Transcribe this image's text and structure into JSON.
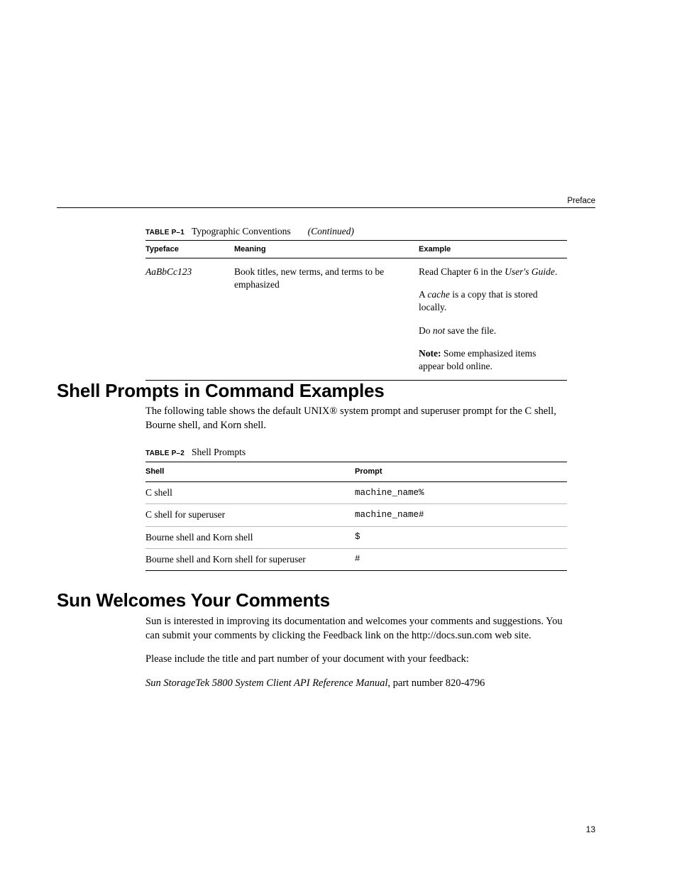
{
  "running_head": "Preface",
  "page_number": "13",
  "table1": {
    "caption_label": "TABLE P–1",
    "caption_title": "Typographic Conventions",
    "caption_cont": "(Continued)",
    "headers": {
      "c1": "Typeface",
      "c2": "Meaning",
      "c3": "Example"
    },
    "row": {
      "typeface": "AaBbCc123",
      "meaning": "Book titles, new terms, and terms to be emphasized",
      "ex1_a": "Read Chapter 6 in the ",
      "ex1_i": "User's Guide",
      "ex1_b": ".",
      "ex2_a": "A ",
      "ex2_i": "cache",
      "ex2_b": " is a copy that is stored locally.",
      "ex3_a": "Do ",
      "ex3_i": "not",
      "ex3_b": " save the file.",
      "ex4_bold": "Note:",
      "ex4_rest": " Some emphasized items appear bold online."
    }
  },
  "section_shell": {
    "heading": "Shell Prompts in Command Examples",
    "intro": "The following table shows the default UNIX® system prompt and superuser prompt for the C shell, Bourne shell, and Korn shell."
  },
  "table2": {
    "caption_label": "TABLE P–2",
    "caption_title": "Shell Prompts",
    "headers": {
      "c1": "Shell",
      "c2": "Prompt"
    },
    "rows": [
      {
        "shell": "C shell",
        "prompt": "machine_name%"
      },
      {
        "shell": "C shell for superuser",
        "prompt": "machine_name#"
      },
      {
        "shell": "Bourne shell and Korn shell",
        "prompt": "$"
      },
      {
        "shell": "Bourne shell and Korn shell for superuser",
        "prompt": "#"
      }
    ]
  },
  "section_comments": {
    "heading": "Sun Welcomes Your Comments",
    "p1": "Sun is interested in improving its documentation and welcomes your comments and suggestions. You can submit your comments by clicking the Feedback link on the http://docs.sun.com web site.",
    "p2": "Please include the title and part number of your document with your feedback:",
    "p3_i": "Sun StorageTek 5800 System Client API Reference Manual",
    "p3_r": ", part number 820-4796"
  }
}
